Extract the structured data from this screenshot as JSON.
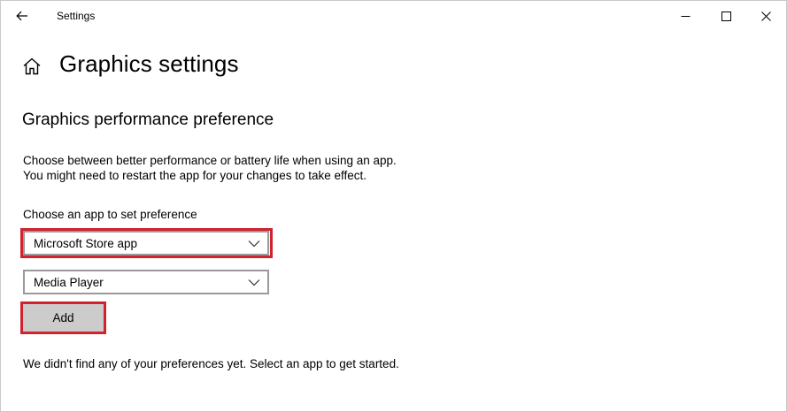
{
  "window": {
    "title": "Settings"
  },
  "page": {
    "title": "Graphics settings",
    "section_title": "Graphics performance preference",
    "description_line1": "Choose between better performance or battery life when using an app.",
    "description_line2": "You might need to restart the app for your changes to take effect.",
    "choose_label": "Choose an app to set preference",
    "app_type_select": {
      "selected": "Microsoft Store app"
    },
    "app_select": {
      "selected": "Media Player"
    },
    "add_button_label": "Add",
    "empty_message": "We didn't find any of your preferences yet. Select an app to get started."
  },
  "colors": {
    "highlight": "#d0232e",
    "button_bg": "#cccccc",
    "dropdown_border": "#9a9a9a"
  },
  "icons": {
    "back": "arrow-left-icon",
    "home": "home-icon",
    "minimize": "minimize-icon",
    "maximize": "maximize-icon",
    "close": "close-icon",
    "chevron": "chevron-down-icon"
  }
}
